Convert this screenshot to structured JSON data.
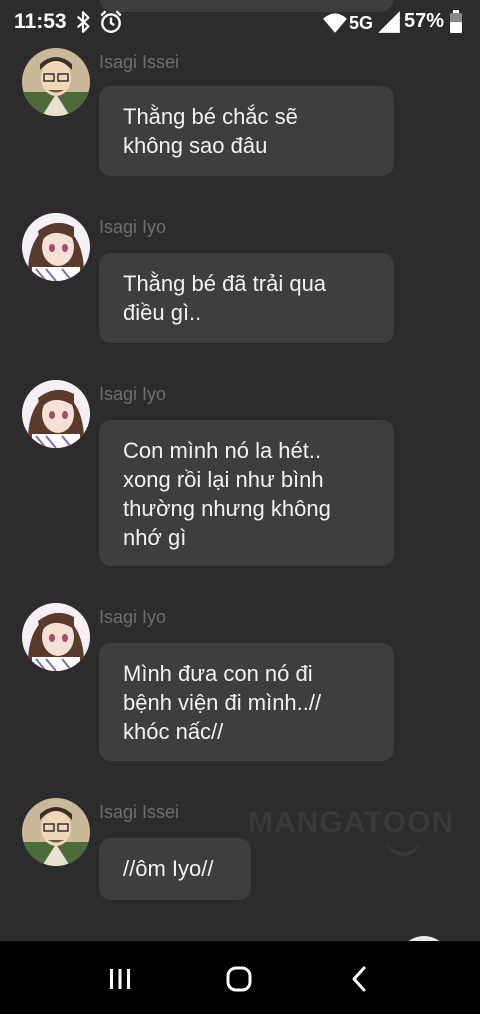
{
  "status_bar": {
    "time": "11:53",
    "battery_percent": "57%",
    "network": "5G",
    "icons": [
      "bluetooth-icon",
      "alarm-icon",
      "wifi-icon",
      "5g-icon",
      "signal-icon",
      "battery-icon"
    ]
  },
  "messages": [
    {
      "sender": "Isagi Issei",
      "avatar": "issei-avatar",
      "text": "Thằng bé chắc sẽ\nkhông sao đâu"
    },
    {
      "sender": "Isagi Iyo",
      "avatar": "iyo-avatar",
      "text": "Thằng bé đã trải qua\nđiều gì.."
    },
    {
      "sender": "Isagi Iyo",
      "avatar": "iyo-avatar",
      "text": "Con mình nó la hét..\nxong rồi lại như bình\nthường nhưng không\nnhớ gì"
    },
    {
      "sender": "Isagi Iyo",
      "avatar": "iyo-avatar",
      "text": "Mình đưa con nó đi\nbệnh viện đi mình..//\nkhóc nấc//"
    },
    {
      "sender": "Isagi Issei",
      "avatar": "issei-avatar",
      "text": "//ôm Iyo//"
    }
  ],
  "watermark": "MANGATOON",
  "nav_bar": {
    "icons": [
      "recent-apps-icon",
      "home-icon",
      "back-icon"
    ]
  },
  "colors": {
    "background": "#2c2c2c",
    "bubble": "#3e3e3e",
    "sender_text": "#6e6e6e",
    "nav_background": "#000000"
  }
}
